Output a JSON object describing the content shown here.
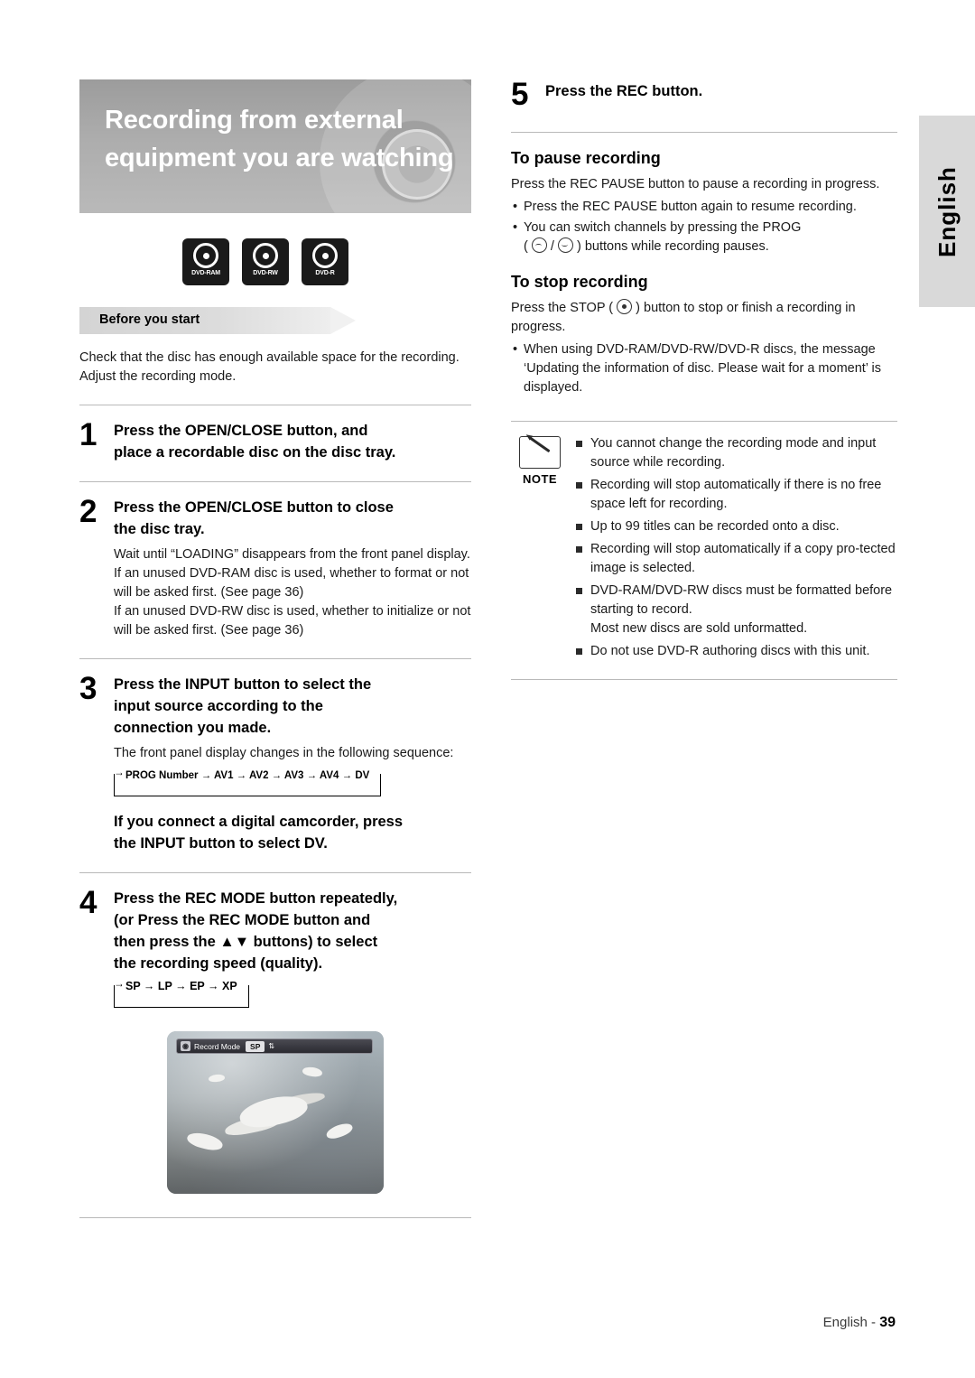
{
  "side_tab": {
    "label": "English"
  },
  "title": {
    "line1": "Recording from external",
    "line2": "equipment you are watching"
  },
  "disc_logos": [
    {
      "name": "dvd-ram-logo",
      "label": "DVD-RAM"
    },
    {
      "name": "dvd-rw-logo",
      "label": "DVD-RW"
    },
    {
      "name": "dvd-r-logo",
      "label": "DVD-R"
    }
  ],
  "before_you_start": {
    "banner_label": "Before you start",
    "text": "Check that the disc has enough available space for the recording. Adjust the recording mode."
  },
  "steps": [
    {
      "number": "1",
      "head_line1": "Press the OPEN/CLOSE button, and",
      "head_line2": "place a recordable disc on the disc tray.",
      "body": []
    },
    {
      "number": "2",
      "head_line1": "Press the OPEN/CLOSE button to close",
      "head_line2": "the disc tray.",
      "body": [
        "Wait until “LOADING” disappears from the front panel display.",
        "If an unused DVD-RAM disc is used, whether to format or not will be asked first. (See page 36)",
        "If an unused DVD-RW disc is used, whether to initialize or not will be asked first. (See page 36)"
      ]
    },
    {
      "number": "3",
      "head_line1": "Press the INPUT button to select the",
      "head_line2": "input source according to the",
      "head_line3": "connection you made.",
      "body": [
        "The front panel display changes in the following sequence:"
      ],
      "sequence": "PROG Number → AV1 → AV2 → AV3 → AV4 → DV"
    },
    {
      "number": "4",
      "head_line1": "Press the REC MODE button repeatedly,",
      "head_line2": "(or Press the REC MODE button and",
      "head_line3": "then press the ▲▼ buttons) to select",
      "head_line4": "the recording speed (quality).",
      "sequence": "SP → LP → EP → XP"
    }
  ],
  "camcorder_note": {
    "line1": "If you connect a digital camcorder, press",
    "line2": "the INPUT button to select DV."
  },
  "screen_shot": {
    "osd_icon": "◉",
    "osd_label": "Record Mode",
    "osd_value": "SP",
    "osd_spinner": "⇅"
  },
  "step5": {
    "number": "5",
    "head": "Press the REC button."
  },
  "pause_section": {
    "title": "To pause recording",
    "intro": "Press the REC PAUSE button to pause a recording in progress.",
    "bullets": [
      "Press the REC PAUSE button again to resume recording.",
      "You can switch channels by pressing the PROG ( ∧ / ∨ ) buttons while recording pauses."
    ]
  },
  "stop_section": {
    "title": "To stop recording",
    "intro_before": "Press the STOP (",
    "intro_after": ") button to stop or finish a recording in progress.",
    "bullets": [
      "When using DVD-RAM/DVD-RW/DVD-R discs, the message ‘Updating the information of disc. Please wait for a moment’ is displayed."
    ]
  },
  "note_box": {
    "label": "NOTE",
    "items": [
      "You cannot change the recording mode and input source while recording.",
      "Recording will stop automatically if there is no free space left for recording.",
      "Up to 99 titles can be recorded onto a disc.",
      "Recording will stop automatically if a copy pro-tected image is selected.",
      "DVD-RAM/DVD-RW discs must be formatted before starting to record.\nMost new discs are sold unformatted.",
      "Do not use DVD-R authoring discs with this unit."
    ]
  },
  "footer": {
    "text": "English -",
    "page": "39"
  }
}
